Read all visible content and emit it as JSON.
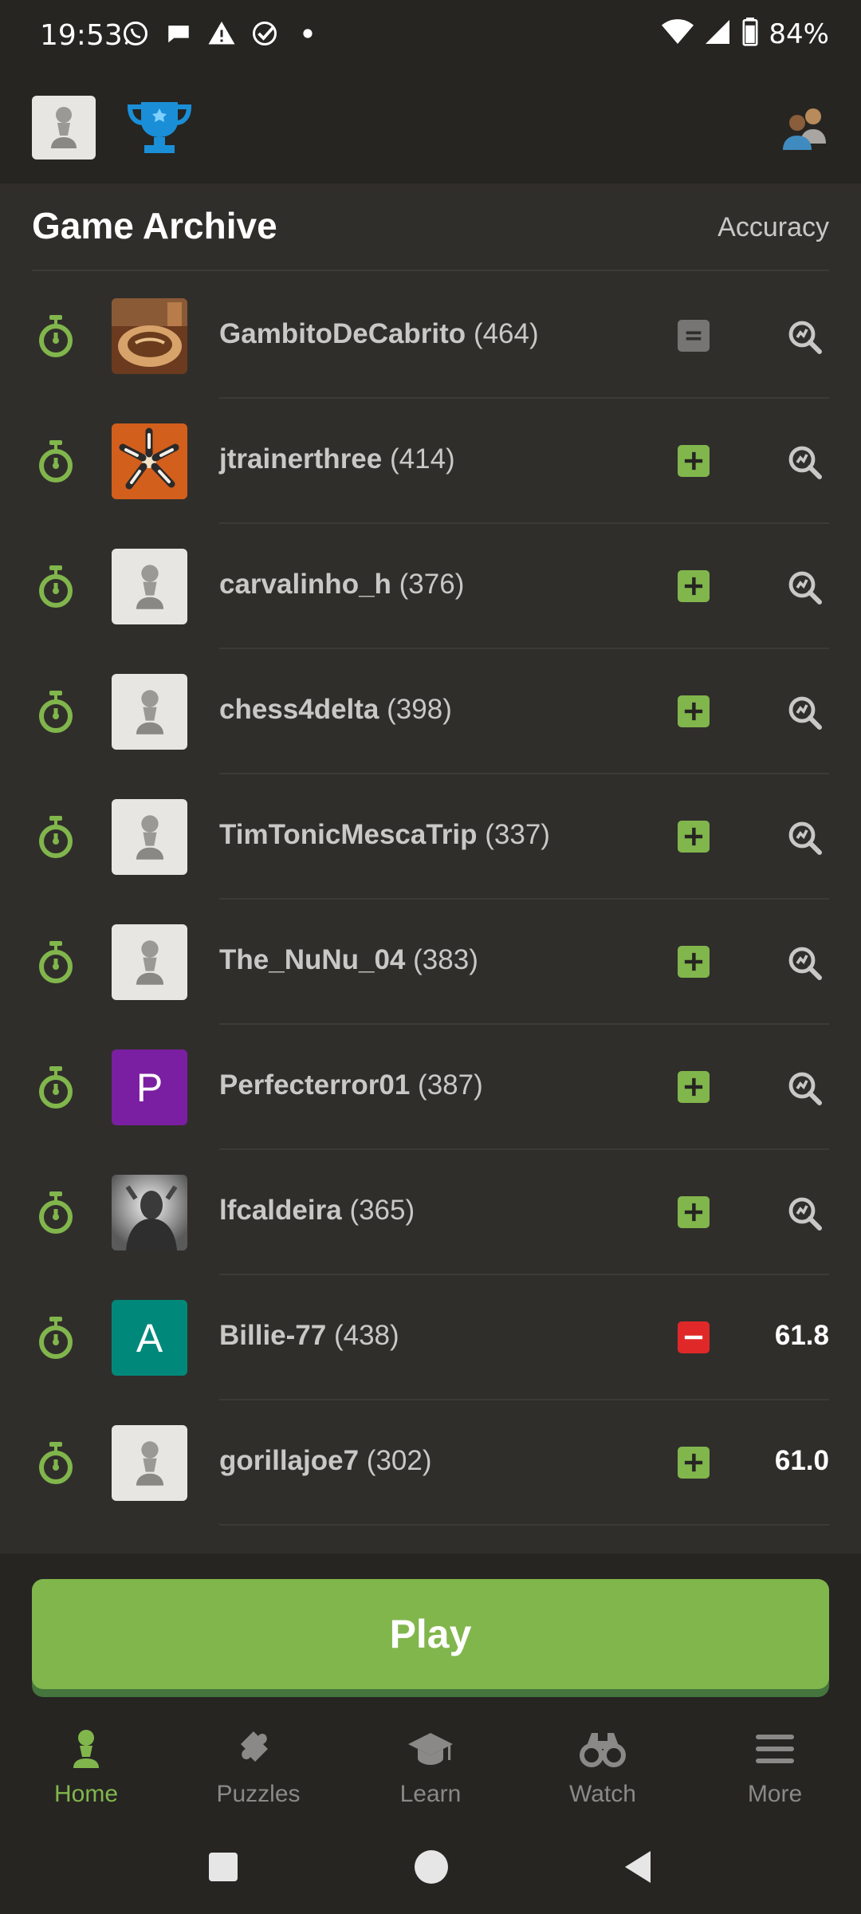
{
  "status_bar": {
    "time": "19:53",
    "battery": "84%",
    "icons": [
      "whatsapp-icon",
      "chat-icon",
      "warning-icon",
      "check-circle-icon",
      "dot-icon",
      "wifi-icon",
      "signal-icon",
      "battery-icon"
    ]
  },
  "app_bar": {
    "left_icons": [
      "pawn-avatar",
      "trophy-icon"
    ],
    "right_icon": "friends-icon"
  },
  "archive": {
    "title": "Game Archive",
    "accuracy_label": "Accuracy",
    "games": [
      {
        "player": "GambitoDeCabrito",
        "rating": "(464)",
        "avatar": "photo-pie",
        "result": "draw",
        "accuracy": null
      },
      {
        "player": "jtrainerthree",
        "rating": "(414)",
        "avatar": "photo-shoes",
        "result": "win",
        "accuracy": null
      },
      {
        "player": "carvalinho_h",
        "rating": "(376)",
        "avatar": "pawn",
        "result": "win",
        "accuracy": null
      },
      {
        "player": "chess4delta",
        "rating": "(398)",
        "avatar": "pawn",
        "result": "win",
        "accuracy": null
      },
      {
        "player": "TimTonicMescaTrip",
        "rating": "(337)",
        "avatar": "pawn",
        "result": "win",
        "accuracy": null
      },
      {
        "player": "The_NuNu_04",
        "rating": "(383)",
        "avatar": "pawn",
        "result": "win",
        "accuracy": null
      },
      {
        "player": "Perfecterror01",
        "rating": "(387)",
        "avatar": "letter",
        "avatar_letter": "P",
        "avatar_color": "#7b1fa2",
        "result": "win",
        "accuracy": null
      },
      {
        "player": "lfcaldeira",
        "rating": "(365)",
        "avatar": "photo-bw",
        "result": "win",
        "accuracy": null
      },
      {
        "player": "Billie-77",
        "rating": "(438)",
        "avatar": "letter",
        "avatar_letter": "A",
        "avatar_color": "#00897b",
        "result": "loss",
        "accuracy": "61.8"
      },
      {
        "player": "gorillajoe7",
        "rating": "(302)",
        "avatar": "pawn",
        "result": "win",
        "accuracy": "61.0"
      }
    ]
  },
  "play_button": {
    "label": "Play"
  },
  "bottom_nav": [
    {
      "label": "Home",
      "icon": "home-icon",
      "active": true
    },
    {
      "label": "Puzzles",
      "icon": "puzzle-icon",
      "active": false
    },
    {
      "label": "Learn",
      "icon": "graduation-cap-icon",
      "active": false
    },
    {
      "label": "Watch",
      "icon": "binoculars-icon",
      "active": false
    },
    {
      "label": "More",
      "icon": "menu-icon",
      "active": false
    }
  ],
  "colors": {
    "accent_green": "#81b64c",
    "win": "#81b64c",
    "loss": "#e02828",
    "draw": "#777573",
    "background": "#302e2b"
  }
}
